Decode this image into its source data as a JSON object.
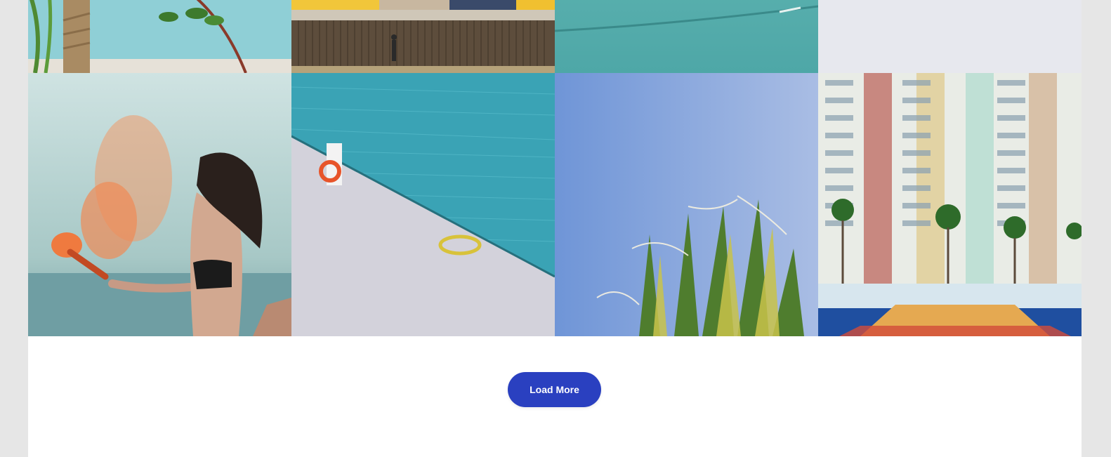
{
  "gallery": {
    "tiles": [
      {
        "name": "tree-trunk-teal-wall-photo"
      },
      {
        "name": "colorful-houses-fence-photo"
      },
      {
        "name": "teal-car-detail-photo"
      },
      {
        "name": "pale-gray-photo"
      },
      {
        "name": "woman-smoke-flare-photo"
      },
      {
        "name": "pier-lifebuoy-hose-photo"
      },
      {
        "name": "palm-leaves-blue-sky-photo"
      },
      {
        "name": "apartment-block-court-photo"
      }
    ]
  },
  "actions": {
    "load_more_label": "Load More",
    "button_color": "#2a40c0"
  }
}
